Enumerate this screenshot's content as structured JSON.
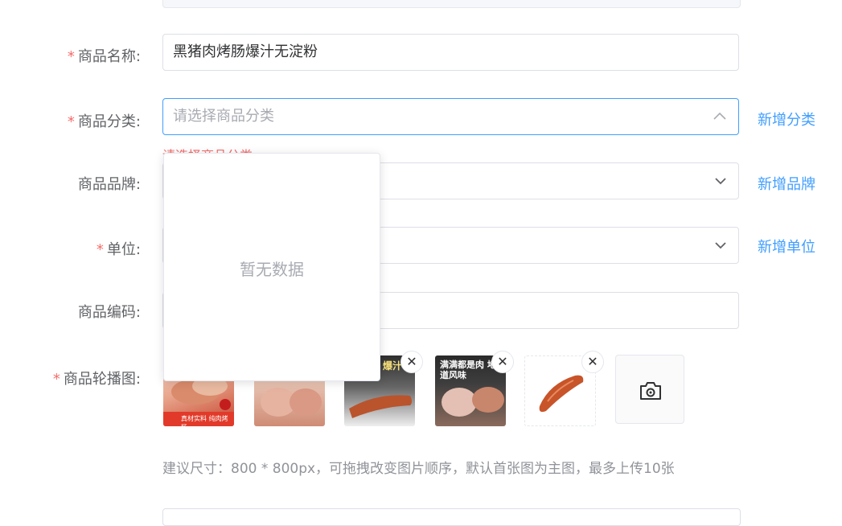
{
  "form": {
    "name": {
      "label": "商品名称:",
      "value": "黑猪肉烤肠爆汁无淀粉"
    },
    "category": {
      "label": "商品分类:",
      "placeholder": "请选择商品分类",
      "error": "请选择商品分类",
      "add_link": "新增分类"
    },
    "brand": {
      "label": "商品品牌:",
      "add_link": "新增品牌"
    },
    "unit": {
      "label": "单位:",
      "add_link": "新增单位"
    },
    "code": {
      "label": "商品编码:"
    },
    "carousel": {
      "label": "商品轮播图:",
      "hint": "建议尺寸：800 * 800px，可拖拽改变图片顺序，默认首张图为主图，最多上传10张"
    }
  },
  "dropdown": {
    "empty_text": "暂无数据"
  },
  "thumbs": [
    {
      "caption": "真材实料 纯肉烤肠"
    },
    {
      "caption": ""
    },
    {
      "caption": "爆汁"
    },
    {
      "caption": "满满都是肉 地道风味"
    },
    {
      "caption": ""
    }
  ],
  "icons": {
    "close": "close-icon",
    "camera": "camera-icon",
    "chevron": "chevron-down-icon"
  },
  "colors": {
    "accent": "#409eff",
    "error": "#f56c6c"
  }
}
